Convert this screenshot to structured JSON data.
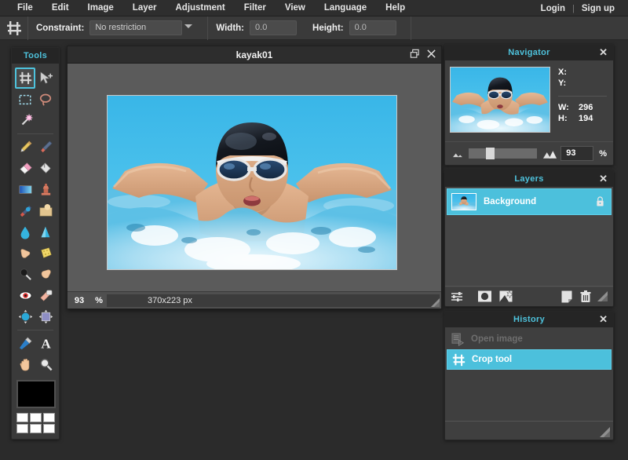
{
  "menu": {
    "items": [
      "File",
      "Edit",
      "Image",
      "Layer",
      "Adjustment",
      "Filter",
      "View",
      "Language",
      "Help"
    ],
    "login": "Login",
    "separator": "|",
    "signup": "Sign up"
  },
  "options_bar": {
    "tool_icon": "crop-tool-icon",
    "constraint_label": "Constraint:",
    "constraint_value": "No restriction",
    "constraint_options": [
      "No restriction"
    ],
    "width_label": "Width:",
    "width_value": "0.0",
    "height_label": "Height:",
    "height_value": "0.0"
  },
  "tools": {
    "title": "Tools",
    "rows": [
      [
        {
          "name": "crop-tool",
          "active": true
        },
        {
          "name": "move-tool",
          "active": false
        }
      ],
      [
        {
          "name": "marquee-select-tool",
          "active": false
        },
        {
          "name": "lasso-tool",
          "active": false
        }
      ],
      [
        {
          "name": "magic-wand-tool",
          "active": false
        }
      ],
      [
        {
          "name": "pencil-tool",
          "active": false
        },
        {
          "name": "brush-tool",
          "active": false
        }
      ],
      [
        {
          "name": "eraser-tool",
          "active": false
        },
        {
          "name": "paint-bucket-tool",
          "active": false
        }
      ],
      [
        {
          "name": "gradient-tool",
          "active": false
        },
        {
          "name": "clone-stamp-tool",
          "active": false
        }
      ],
      [
        {
          "name": "smudge-tool",
          "active": false
        },
        {
          "name": "replace-color-tool",
          "active": false
        }
      ],
      [
        {
          "name": "blur-tool",
          "active": false
        },
        {
          "name": "sharpen-tool",
          "active": false
        }
      ],
      [
        {
          "name": "dodge-tool",
          "active": false
        },
        {
          "name": "sponge-tool",
          "active": false
        }
      ],
      [
        {
          "name": "burn-tool",
          "active": false
        },
        {
          "name": "pinch-tool",
          "active": false
        }
      ],
      [
        {
          "name": "red-eye-tool",
          "active": false
        },
        {
          "name": "heal-tool",
          "active": false
        }
      ],
      [
        {
          "name": "bloat-tool",
          "active": false
        },
        {
          "name": "warp-tool",
          "active": false
        }
      ],
      [
        {
          "name": "eyedropper-tool",
          "active": false
        },
        {
          "name": "type-tool",
          "active": false
        }
      ],
      [
        {
          "name": "hand-tool",
          "active": false
        },
        {
          "name": "zoom-tool",
          "active": false
        }
      ]
    ],
    "foreground_color": "#000000",
    "palette_colors": [
      "#ffffff",
      "#ffffff",
      "#ffffff",
      "#ffffff",
      "#ffffff",
      "#ffffff"
    ]
  },
  "document": {
    "title": "kayak01",
    "restore_icon": "restore-window-icon",
    "close_icon": "close-icon",
    "zoom_value": "93",
    "zoom_unit": "%",
    "dimensions": "370x223 px",
    "image_alt": "swimmer-butterfly-stroke-photo"
  },
  "navigator": {
    "title": "Navigator",
    "close_icon": "close-icon",
    "x_label": "X:",
    "x_value": "",
    "y_label": "Y:",
    "y_value": "",
    "w_label": "W:",
    "w_value": "296",
    "h_label": "H:",
    "h_value": "194",
    "zoom_out_icon": "small-mountain-icon",
    "zoom_in_icon": "large-mountain-icon",
    "zoom_value": "93",
    "zoom_unit": "%"
  },
  "layers": {
    "title": "Layers",
    "close_icon": "close-icon",
    "items": [
      {
        "name": "Background",
        "locked": true,
        "selected": true
      }
    ],
    "toolbar": [
      {
        "name": "layer-settings-icon"
      },
      {
        "name": "layer-mask-icon"
      },
      {
        "name": "add-layer-style-icon"
      },
      {
        "name": "duplicate-layer-icon"
      },
      {
        "name": "delete-layer-icon"
      },
      {
        "name": "resize-grip-icon"
      }
    ]
  },
  "history": {
    "title": "History",
    "close_icon": "close-icon",
    "items": [
      {
        "label": "Open image",
        "icon": "open-image-icon",
        "state": "dim"
      },
      {
        "label": "Crop tool",
        "icon": "crop-tool-icon",
        "state": "active"
      }
    ]
  },
  "theme": {
    "accent": "#4ec3dd",
    "selection": "#4cc0dc",
    "panel_bg": "#3f3f3f",
    "header_bg": "#252525",
    "canvas_bg": "#5b5b5b"
  }
}
